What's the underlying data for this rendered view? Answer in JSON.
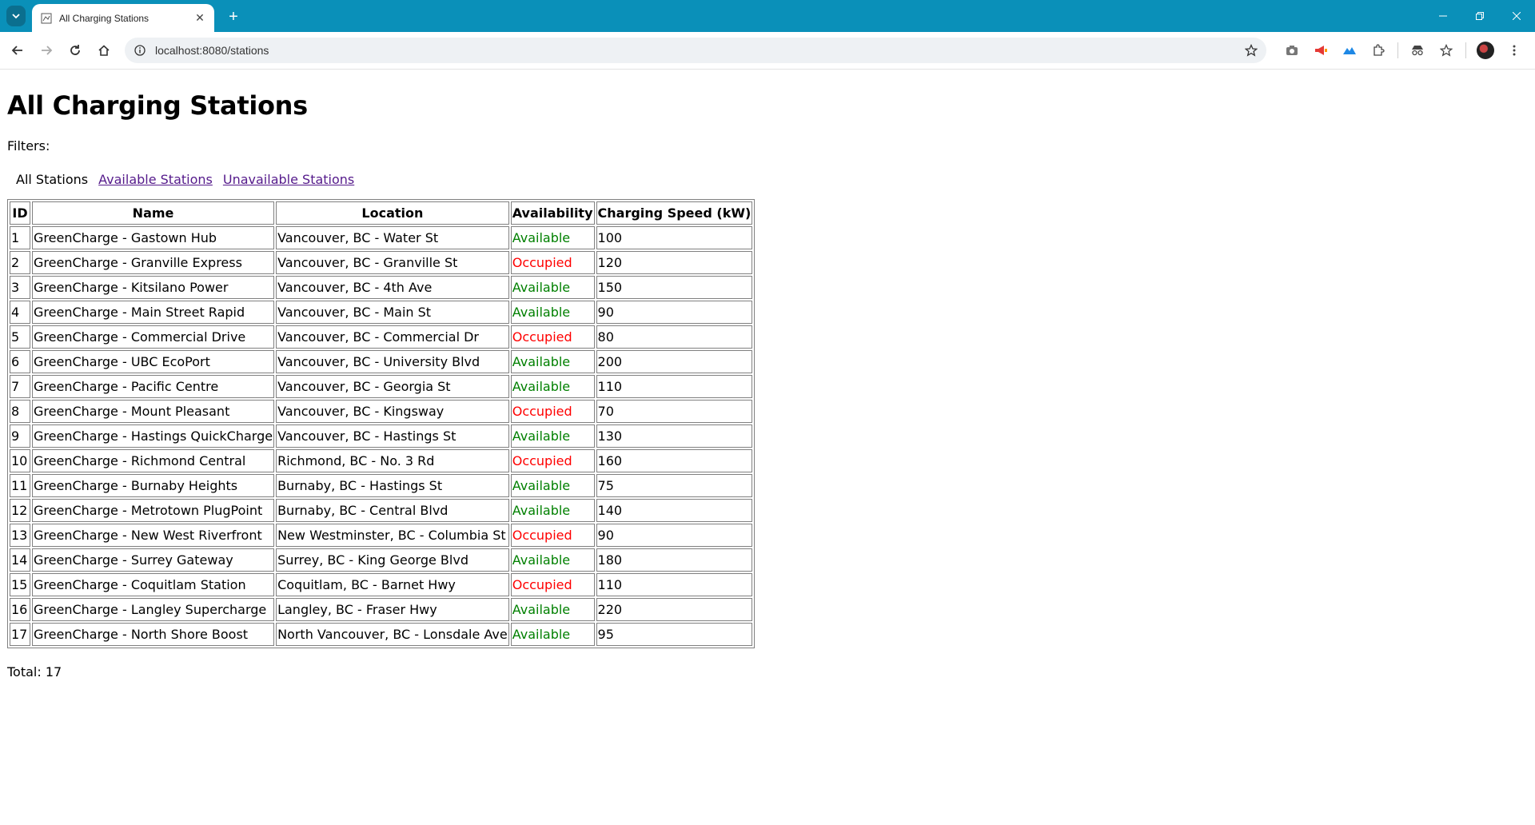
{
  "browser": {
    "tab_title": "All Charging Stations",
    "url": "localhost:8080/stations"
  },
  "page": {
    "title": "All Charging Stations",
    "filters_label": "Filters:",
    "filters": {
      "all": "All Stations",
      "available": "Available Stations",
      "unavailable": "Unavailable Stations"
    },
    "table": {
      "headers": [
        "ID",
        "Name",
        "Location",
        "Availability",
        "Charging Speed (kW)"
      ],
      "rows": [
        {
          "id": "1",
          "name": "GreenCharge - Gastown Hub",
          "location": "Vancouver, BC - Water St",
          "availability": "Available",
          "speed": "100"
        },
        {
          "id": "2",
          "name": "GreenCharge - Granville Express",
          "location": "Vancouver, BC - Granville St",
          "availability": "Occupied",
          "speed": "120"
        },
        {
          "id": "3",
          "name": "GreenCharge - Kitsilano Power",
          "location": "Vancouver, BC - 4th Ave",
          "availability": "Available",
          "speed": "150"
        },
        {
          "id": "4",
          "name": "GreenCharge - Main Street Rapid",
          "location": "Vancouver, BC - Main St",
          "availability": "Available",
          "speed": "90"
        },
        {
          "id": "5",
          "name": "GreenCharge - Commercial Drive",
          "location": "Vancouver, BC - Commercial Dr",
          "availability": "Occupied",
          "speed": "80"
        },
        {
          "id": "6",
          "name": "GreenCharge - UBC EcoPort",
          "location": "Vancouver, BC - University Blvd",
          "availability": "Available",
          "speed": "200"
        },
        {
          "id": "7",
          "name": "GreenCharge - Pacific Centre",
          "location": "Vancouver, BC - Georgia St",
          "availability": "Available",
          "speed": "110"
        },
        {
          "id": "8",
          "name": "GreenCharge - Mount Pleasant",
          "location": "Vancouver, BC - Kingsway",
          "availability": "Occupied",
          "speed": "70"
        },
        {
          "id": "9",
          "name": "GreenCharge - Hastings QuickCharge",
          "location": "Vancouver, BC - Hastings St",
          "availability": "Available",
          "speed": "130"
        },
        {
          "id": "10",
          "name": "GreenCharge - Richmond Central",
          "location": "Richmond, BC - No. 3 Rd",
          "availability": "Occupied",
          "speed": "160"
        },
        {
          "id": "11",
          "name": "GreenCharge - Burnaby Heights",
          "location": "Burnaby, BC - Hastings St",
          "availability": "Available",
          "speed": "75"
        },
        {
          "id": "12",
          "name": "GreenCharge - Metrotown PlugPoint",
          "location": "Burnaby, BC - Central Blvd",
          "availability": "Available",
          "speed": "140"
        },
        {
          "id": "13",
          "name": "GreenCharge - New West Riverfront",
          "location": "New Westminster, BC - Columbia St",
          "availability": "Occupied",
          "speed": "90"
        },
        {
          "id": "14",
          "name": "GreenCharge - Surrey Gateway",
          "location": "Surrey, BC - King George Blvd",
          "availability": "Available",
          "speed": "180"
        },
        {
          "id": "15",
          "name": "GreenCharge - Coquitlam Station",
          "location": "Coquitlam, BC - Barnet Hwy",
          "availability": "Occupied",
          "speed": "110"
        },
        {
          "id": "16",
          "name": "GreenCharge - Langley Supercharge",
          "location": "Langley, BC - Fraser Hwy",
          "availability": "Available",
          "speed": "220"
        },
        {
          "id": "17",
          "name": "GreenCharge - North Shore Boost",
          "location": "North Vancouver, BC - Lonsdale Ave",
          "availability": "Available",
          "speed": "95"
        }
      ]
    },
    "total_text": "Total: 17"
  },
  "colors": {
    "available": "#008000",
    "occupied": "#ff0000",
    "tabbar": "#0a90b9",
    "visited_link": "#551a8b"
  }
}
